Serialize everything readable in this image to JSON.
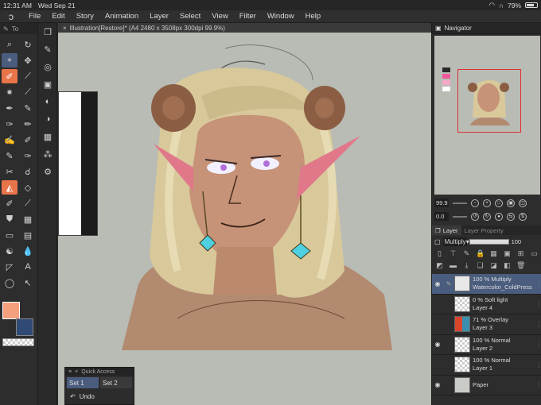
{
  "status": {
    "time": "12:31 AM",
    "date": "Wed Sep 21",
    "battery": "79%",
    "battery_level": 0.79
  },
  "menu": [
    "File",
    "Edit",
    "Story",
    "Animation",
    "Layer",
    "Select",
    "View",
    "Filter",
    "Window",
    "Help"
  ],
  "toolbox": {
    "header_label": "To"
  },
  "canvas": {
    "tab_title": "Illustration[Restore]* (A4 2480 x 3508px 300dpi 99.9%)"
  },
  "navigator": {
    "title": "Navigator",
    "zoom": "99.9",
    "rotation": "0.0"
  },
  "layer_panel": {
    "tab_layer": "Layer",
    "tab_property": "Layer Property",
    "blend_mode": "Multiply",
    "opacity": "100",
    "layers": [
      {
        "line1": "100 % Multiply",
        "line2": "Watercolor_ColdPress",
        "visible": true,
        "selected": true
      },
      {
        "line1": "0 % Soft light",
        "line2": "Layer 4",
        "visible": false,
        "selected": false
      },
      {
        "line1": "71 % Overlay",
        "line2": "Layer 3",
        "visible": false,
        "selected": false
      },
      {
        "line1": "100 % Normal",
        "line2": "Layer 2",
        "visible": true,
        "selected": false
      },
      {
        "line1": "100 % Normal",
        "line2": "Layer 1",
        "visible": false,
        "selected": false
      },
      {
        "line1": "",
        "line2": "Paper",
        "visible": true,
        "selected": false
      }
    ]
  },
  "quick_access": {
    "title": "Quick Access",
    "set1": "Set 1",
    "set2": "Set 2",
    "undo": "Undo"
  },
  "colors": {
    "main": "#f4a07e",
    "sub": "#2f4a74",
    "accent": "#4a5d7e",
    "active_tool": "#e8744a"
  }
}
